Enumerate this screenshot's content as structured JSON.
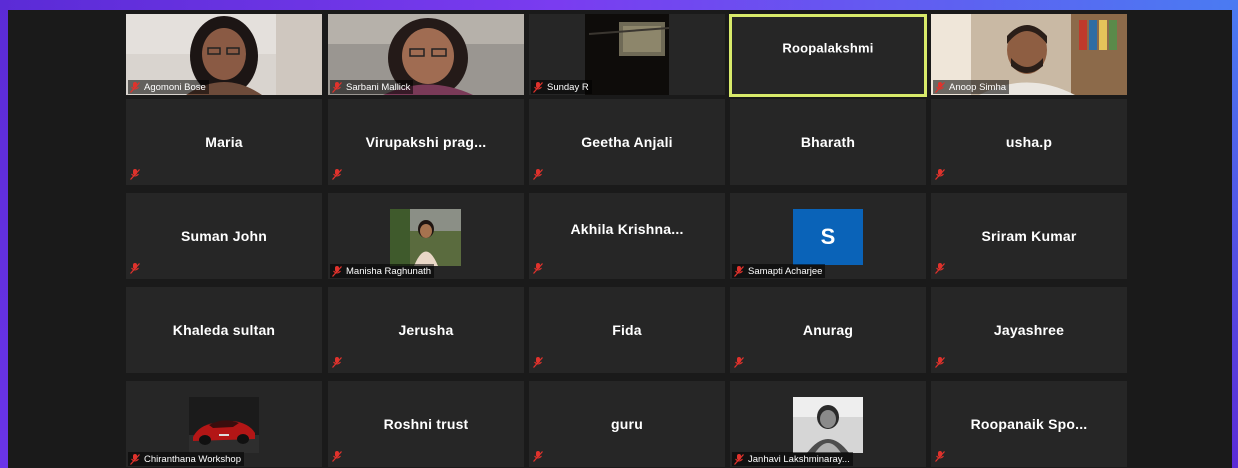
{
  "app": {
    "title": "Zoom Meeting - Gallery View"
  },
  "colors": {
    "tile_bg": "#262626",
    "active_border": "#d8ea6a",
    "avatar_bg": "#0a63b8",
    "muted_mic": "#e0322c"
  },
  "rows": [
    [
      {
        "name": "Agomoni Bose",
        "type": "video"
      },
      {
        "name": "Sarbani Mallick",
        "type": "video"
      },
      {
        "name": "Sunday R",
        "type": "video"
      },
      {
        "name": "Roopalakshmi",
        "type": "name",
        "active": true
      },
      {
        "name": "Anoop Simha",
        "type": "video"
      }
    ],
    [
      {
        "name": "Maria",
        "type": "name"
      },
      {
        "name": "Virupakshi prag...",
        "type": "name"
      },
      {
        "name": "Geetha Anjali",
        "type": "name"
      },
      {
        "name": "Bharath",
        "type": "name"
      },
      {
        "name": "usha.p",
        "type": "name"
      }
    ],
    [
      {
        "name": "Suman John",
        "type": "name"
      },
      {
        "name": "Manisha Raghunath",
        "type": "photo"
      },
      {
        "name": "Akhila Krishna...",
        "type": "name"
      },
      {
        "name": "Samapti Acharjee",
        "type": "avatar",
        "avatar_letter": "S"
      },
      {
        "name": "Sriram Kumar",
        "type": "name"
      }
    ],
    [
      {
        "name": "Khaleda sultan",
        "type": "name"
      },
      {
        "name": "Jerusha",
        "type": "name"
      },
      {
        "name": "Fida",
        "type": "name"
      },
      {
        "name": "Anurag",
        "type": "name"
      },
      {
        "name": "Jayashree",
        "type": "name"
      }
    ],
    [
      {
        "name": "Chiranthana Workshop",
        "type": "photo"
      },
      {
        "name": "Roshni trust",
        "type": "name"
      },
      {
        "name": "guru",
        "type": "name"
      },
      {
        "name": "Janhavi Lakshminaray...",
        "type": "photo"
      },
      {
        "name": "Roopanaik Spo...",
        "type": "name"
      }
    ]
  ]
}
